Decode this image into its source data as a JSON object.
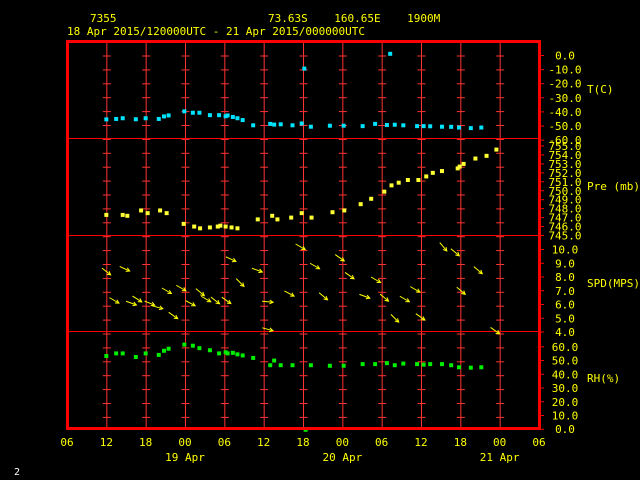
{
  "header": {
    "station": "7355",
    "location": "73.63S    160.65E    1900M",
    "period": "18 Apr 2015/120000UTC - 21 Apr 2015/000000UTC"
  },
  "footer": {
    "page_number": "2"
  },
  "colors": {
    "frame": "#ff0000",
    "grid": "#ff3333",
    "text": "#ffff00",
    "temp": "#00e5ff",
    "pres": "#ffff33",
    "wind": "#ffff00",
    "rh": "#00ee00"
  },
  "chart_data": {
    "type": "scatter",
    "x_unit": "hours since 18 Apr 2015 06 UTC",
    "x_range": [
      0,
      72
    ],
    "x_ticks": [
      "06",
      "12",
      "18",
      "00",
      "06",
      "12",
      "18",
      "00",
      "06",
      "12",
      "18",
      "00",
      "06"
    ],
    "x_tick_hours": [
      0,
      6,
      12,
      18,
      24,
      30,
      36,
      42,
      48,
      54,
      60,
      66,
      72
    ],
    "day_labels": [
      {
        "hour": 18,
        "text": "19 Apr"
      },
      {
        "hour": 42,
        "text": "20 Apr"
      },
      {
        "hour": 66,
        "text": "21 Apr"
      }
    ],
    "grid": true,
    "panels": [
      {
        "key": "temp",
        "label": "T(C)",
        "range": [
          -60,
          0
        ],
        "tick_step": 10,
        "tick_labels": [
          "0.0",
          "-10.0",
          "-20.0",
          "-30.0",
          "-40.0",
          "-50.0",
          "-60.0"
        ],
        "points": [
          [
            6,
            -45.3
          ],
          [
            7.5,
            -45
          ],
          [
            8.5,
            -44.5
          ],
          [
            10.5,
            -45.2
          ],
          [
            12,
            -44.5
          ],
          [
            14,
            -45
          ],
          [
            14.8,
            -43.2
          ],
          [
            15.5,
            -42.5
          ],
          [
            17.9,
            -39.6
          ],
          [
            19.2,
            -40.6
          ],
          [
            20.2,
            -40.6
          ],
          [
            21.8,
            -42.3
          ],
          [
            23.2,
            -42.3
          ],
          [
            24.2,
            -43.1
          ],
          [
            24.5,
            -42.5
          ],
          [
            25.3,
            -43.6
          ],
          [
            26,
            -44.5
          ],
          [
            26.8,
            -45.8
          ],
          [
            28.4,
            -49.5
          ],
          [
            31,
            -48.5
          ],
          [
            31.6,
            -49
          ],
          [
            32.6,
            -48.8
          ],
          [
            34.4,
            -49.5
          ],
          [
            35.8,
            -48.2
          ],
          [
            37.2,
            -50.5
          ],
          [
            40.1,
            -49.8
          ],
          [
            42.2,
            -49.8
          ],
          [
            45.1,
            -50.1
          ],
          [
            47,
            -48.5
          ],
          [
            48.8,
            -49.3
          ],
          [
            50,
            -49.1
          ],
          [
            51.3,
            -49.5
          ],
          [
            53.4,
            -50.1
          ],
          [
            54.4,
            -50.1
          ],
          [
            55.4,
            -50.2
          ],
          [
            57.2,
            -50.5
          ],
          [
            58.6,
            -50.6
          ],
          [
            59.8,
            -51.1
          ],
          [
            61.6,
            -51.5
          ],
          [
            63.2,
            -51.1
          ],
          [
            36.2,
            -9.3
          ],
          [
            49.3,
            1.2
          ]
        ]
      },
      {
        "key": "pres",
        "label": "Pre (mb)",
        "range": [
          745,
          756
        ],
        "tick_step": 1,
        "tick_labels": [
          "755.0",
          "754.0",
          "753.0",
          "752.0",
          "751.0",
          "750.0",
          "749.0",
          "748.0",
          "747.0",
          "746.0",
          "745.0"
        ],
        "points": [
          [
            6,
            747.3
          ],
          [
            8.5,
            747.3
          ],
          [
            9.2,
            747.2
          ],
          [
            11.3,
            747.8
          ],
          [
            12.3,
            747.5
          ],
          [
            14.2,
            747.8
          ],
          [
            15.2,
            747.5
          ],
          [
            17.8,
            746.3
          ],
          [
            19.4,
            746
          ],
          [
            20.3,
            745.8
          ],
          [
            21.8,
            745.9
          ],
          [
            23,
            746
          ],
          [
            23.4,
            746.1
          ],
          [
            24.2,
            746
          ],
          [
            25.1,
            745.9
          ],
          [
            26,
            745.8
          ],
          [
            29.1,
            746.8
          ],
          [
            31.3,
            747.2
          ],
          [
            32.1,
            746.8
          ],
          [
            34.2,
            747
          ],
          [
            35.8,
            747.5
          ],
          [
            37.3,
            747
          ],
          [
            40.5,
            747.6
          ],
          [
            42.3,
            747.8
          ],
          [
            44.8,
            748.5
          ],
          [
            46.4,
            749.1
          ],
          [
            48.4,
            749.9
          ],
          [
            49.5,
            750.6
          ],
          [
            50.6,
            750.9
          ],
          [
            52,
            751.2
          ],
          [
            53.6,
            751.2
          ],
          [
            54.8,
            751.6
          ],
          [
            55.8,
            752
          ],
          [
            57.2,
            752.2
          ],
          [
            59.6,
            752.5
          ],
          [
            59.9,
            752.7
          ],
          [
            60.5,
            753
          ],
          [
            62.3,
            753.6
          ],
          [
            64,
            753.9
          ],
          [
            65.5,
            754.6
          ]
        ]
      },
      {
        "key": "wind",
        "label": "SPD(MPS)",
        "range": [
          4,
          11
        ],
        "tick_step": 1,
        "tick_labels": [
          "10.0",
          "9.0",
          "8.0",
          "7.0",
          "6.0",
          "5.0",
          "4.0"
        ],
        "points": [
          [
            6,
            8.4,
            -38
          ],
          [
            7.2,
            6.3,
            -30
          ],
          [
            8.8,
            8.6,
            -25
          ],
          [
            9.8,
            6.1,
            -20
          ],
          [
            10.7,
            6.4,
            -32
          ],
          [
            12.6,
            6.1,
            -22
          ],
          [
            13.8,
            5.8,
            -15
          ],
          [
            15.2,
            7,
            -30
          ],
          [
            16.2,
            5.2,
            -35
          ],
          [
            17.4,
            7.2,
            -30
          ],
          [
            18.8,
            6.1,
            -28
          ],
          [
            20.3,
            6.9,
            -40
          ],
          [
            21.2,
            6.4,
            -30
          ],
          [
            22.6,
            6.3,
            -38
          ],
          [
            24.3,
            6.3,
            -35
          ],
          [
            25,
            9.3,
            -25
          ],
          [
            26.4,
            7.6,
            -45
          ],
          [
            29,
            8.5,
            -20
          ],
          [
            30.6,
            6.2,
            -5
          ],
          [
            33.9,
            6.8,
            -28
          ],
          [
            35.6,
            10.2,
            -30
          ],
          [
            37.8,
            8.8,
            -30
          ],
          [
            39.1,
            6.6,
            -40
          ],
          [
            41.6,
            9.4,
            -35
          ],
          [
            43.1,
            8.1,
            -35
          ],
          [
            45.4,
            6.6,
            -20
          ],
          [
            47.1,
            7.8,
            -30
          ],
          [
            48.4,
            6.5,
            -40
          ],
          [
            50,
            5,
            -45
          ],
          [
            51.5,
            6.4,
            -30
          ],
          [
            53.1,
            7.1,
            -30
          ],
          [
            53.9,
            5.1,
            -35
          ],
          [
            57.4,
            10.2,
            -50
          ],
          [
            59.2,
            9.8,
            -40
          ],
          [
            60.1,
            7,
            -40
          ],
          [
            62.7,
            8.5,
            -40
          ],
          [
            65.3,
            4.1,
            -35
          ],
          [
            30.6,
            4.2,
            -15
          ]
        ]
      },
      {
        "key": "rh",
        "label": "RH(%)",
        "range": [
          0,
          70
        ],
        "tick_step": 10,
        "tick_labels": [
          "60.0",
          "50.0",
          "40.0",
          "30.0",
          "20.0",
          "10.0",
          "0.0"
        ],
        "points": [
          [
            6,
            53.3
          ],
          [
            7.5,
            55.2
          ],
          [
            8.5,
            55.2
          ],
          [
            10.5,
            52.6
          ],
          [
            12,
            55.2
          ],
          [
            14,
            54.1
          ],
          [
            14.8,
            57.1
          ],
          [
            15.5,
            58.6
          ],
          [
            17.9,
            61.6
          ],
          [
            19.2,
            60.8
          ],
          [
            20.2,
            59
          ],
          [
            21.8,
            57.5
          ],
          [
            23.2,
            55.2
          ],
          [
            24.2,
            56
          ],
          [
            24.5,
            55.2
          ],
          [
            25.3,
            55.6
          ],
          [
            26,
            54.5
          ],
          [
            26.8,
            53.7
          ],
          [
            28.4,
            51.9
          ],
          [
            31,
            46.6
          ],
          [
            31.6,
            50
          ],
          [
            32.6,
            46.6
          ],
          [
            34.4,
            46.6
          ],
          [
            36.4,
            -0.4
          ],
          [
            37.2,
            46.6
          ],
          [
            40.1,
            46.2
          ],
          [
            42.2,
            46.2
          ],
          [
            45.1,
            47.4
          ],
          [
            47,
            47.4
          ],
          [
            48.8,
            48.1
          ],
          [
            50,
            46.6
          ],
          [
            51.3,
            47.8
          ],
          [
            53.4,
            47.4
          ],
          [
            54.4,
            47
          ],
          [
            55.4,
            47.4
          ],
          [
            57.2,
            47.4
          ],
          [
            58.6,
            46.6
          ],
          [
            59.8,
            45.1
          ],
          [
            61.6,
            44.8
          ],
          [
            63.2,
            45.1
          ]
        ]
      }
    ]
  }
}
